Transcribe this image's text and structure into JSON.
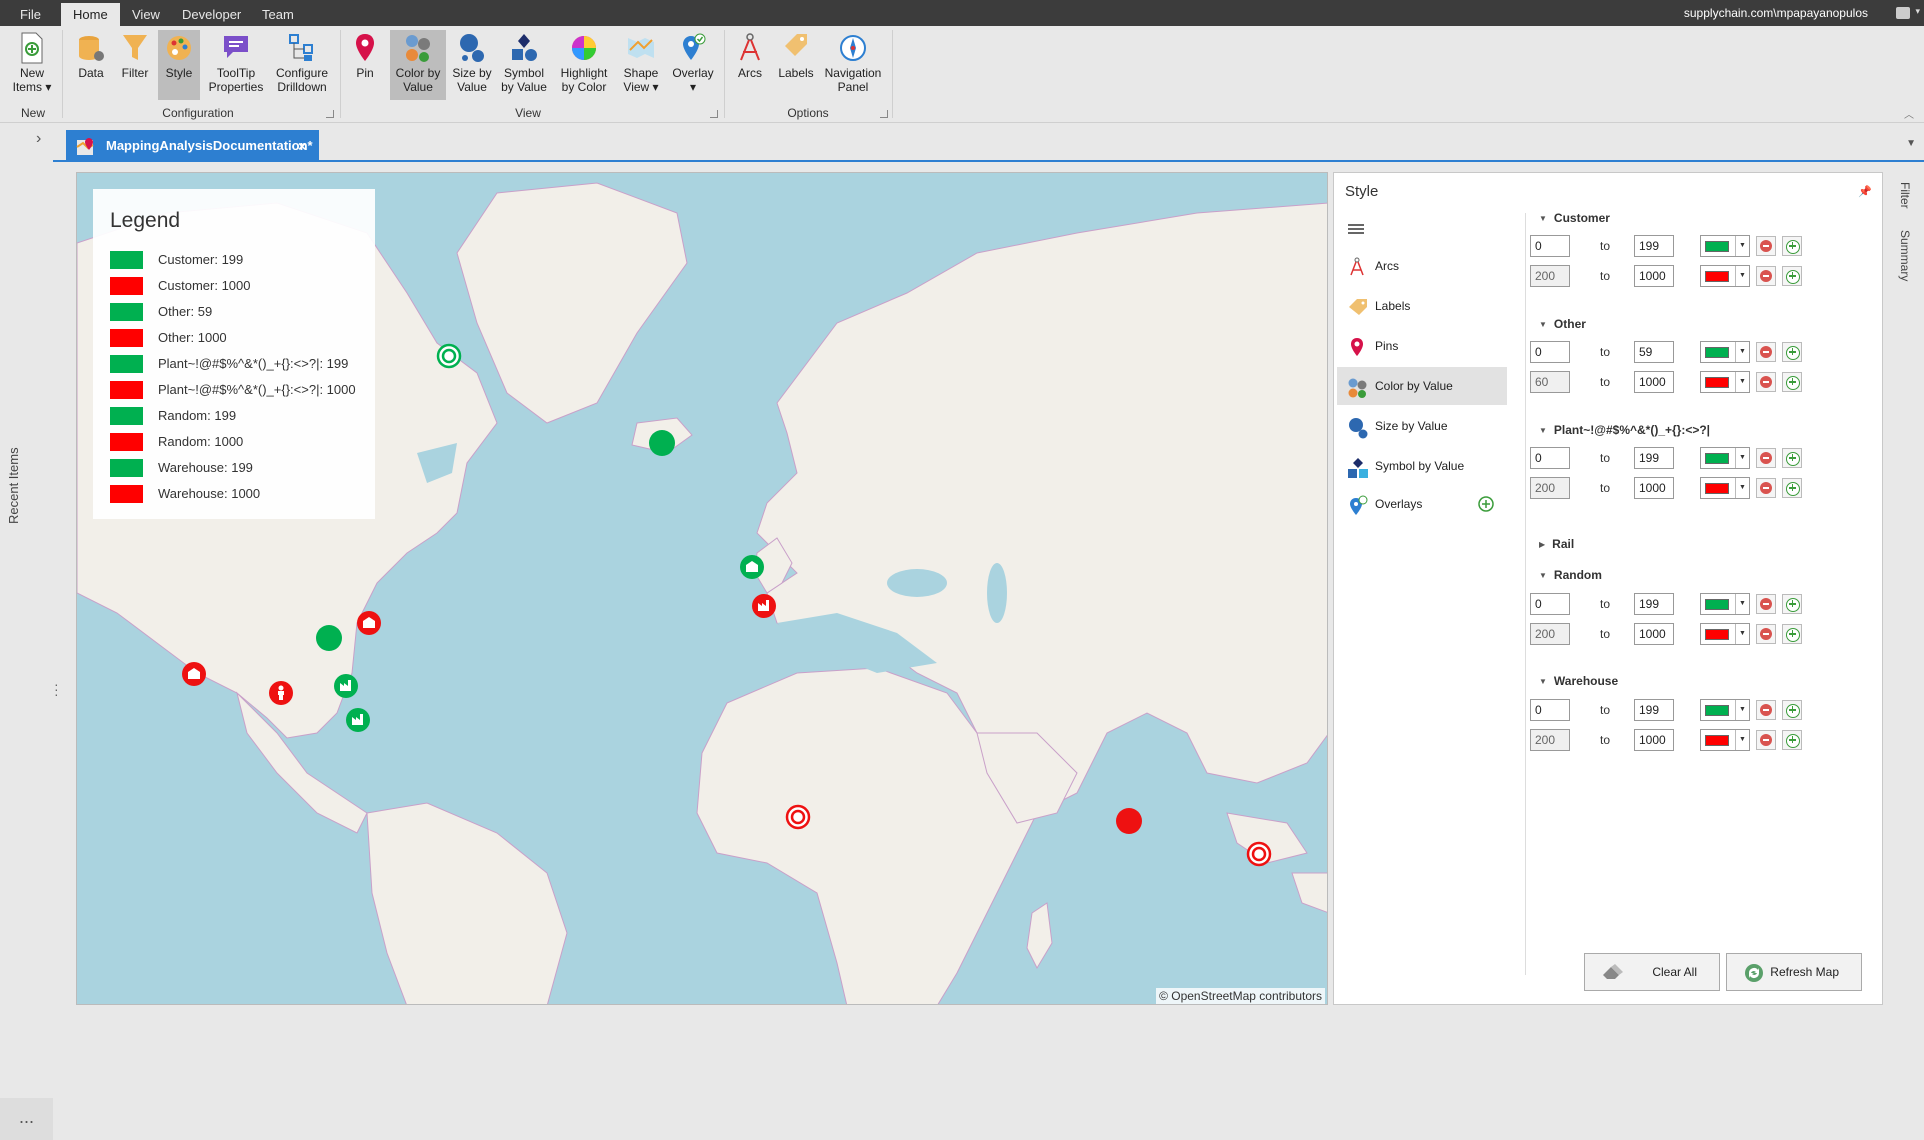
{
  "titlebar": {
    "tabs": [
      {
        "label": "File"
      },
      {
        "label": "Home"
      },
      {
        "label": "View"
      },
      {
        "label": "Developer"
      },
      {
        "label": "Team"
      }
    ],
    "user": "supplychain.com\\mpapayanopulos"
  },
  "ribbon": {
    "groups": {
      "new": "New",
      "configuration": "Configuration",
      "view": "View",
      "options": "Options"
    },
    "buttons": {
      "new_items": [
        "New",
        "Items ▾"
      ],
      "data": [
        "Data"
      ],
      "filter": [
        "Filter"
      ],
      "style": [
        "Style"
      ],
      "tooltip_properties": [
        "ToolTip",
        "Properties"
      ],
      "configure_drilldown": [
        "Configure",
        "Drilldown"
      ],
      "pin": [
        "Pin"
      ],
      "color_by_value": [
        "Color by",
        "Value"
      ],
      "size_by_value": [
        "Size by",
        "Value"
      ],
      "symbol_by_value": [
        "Symbol",
        "by Value"
      ],
      "highlight_by_color": [
        "Highlight",
        "by Color"
      ],
      "shape_view": [
        "Shape",
        "View ▾"
      ],
      "overlay": [
        "Overlay",
        "▾"
      ],
      "arcs": [
        "Arcs"
      ],
      "labels": [
        "Labels"
      ],
      "navigation_panel": [
        "Navigation",
        "Panel"
      ]
    }
  },
  "left_rail": {
    "recent_items": "Recent Items",
    "more": "..."
  },
  "document_tab": {
    "title": "MappingAnalysisDocumentation*",
    "close": "×"
  },
  "legend": {
    "title": "Legend",
    "items": [
      {
        "label": "Customer: 199",
        "color": "#00b050"
      },
      {
        "label": "Customer: 1000",
        "color": "#ff0000"
      },
      {
        "label": "Other: 59",
        "color": "#00b050"
      },
      {
        "label": "Other: 1000",
        "color": "#ff0000"
      },
      {
        "label": "Plant~!@#$%^&*()_+{}:<>?|: 199",
        "color": "#00b050"
      },
      {
        "label": "Plant~!@#$%^&*()_+{}:<>?|: 1000",
        "color": "#ff0000"
      },
      {
        "label": "Random: 199",
        "color": "#00b050"
      },
      {
        "label": "Random: 1000",
        "color": "#ff0000"
      },
      {
        "label": "Warehouse: 199",
        "color": "#00b050"
      },
      {
        "label": "Warehouse: 1000",
        "color": "#ff0000"
      }
    ]
  },
  "map": {
    "attribution": "© OpenStreetMap contributors"
  },
  "style_panel": {
    "title": "Style",
    "nav": [
      {
        "label": "Arcs"
      },
      {
        "label": "Labels"
      },
      {
        "label": "Pins"
      },
      {
        "label": "Color by Value"
      },
      {
        "label": "Size by Value"
      },
      {
        "label": "Symbol by Value"
      },
      {
        "label": "Overlays"
      }
    ],
    "range_separator": "to",
    "sections": [
      {
        "name": "Customer",
        "expanded": true,
        "rows": [
          {
            "min": "0",
            "max": "199",
            "color": "#00b050"
          },
          {
            "min": "200",
            "max": "1000",
            "color": "#ff0000"
          }
        ]
      },
      {
        "name": "Other",
        "expanded": true,
        "rows": [
          {
            "min": "0",
            "max": "59",
            "color": "#00b050"
          },
          {
            "min": "60",
            "max": "1000",
            "color": "#ff0000"
          }
        ]
      },
      {
        "name": "Plant~!@#$%^&*()_+{}:<>?|",
        "expanded": true,
        "rows": [
          {
            "min": "0",
            "max": "199",
            "color": "#00b050"
          },
          {
            "min": "200",
            "max": "1000",
            "color": "#ff0000"
          }
        ]
      },
      {
        "name": "Rail",
        "expanded": false,
        "rows": []
      },
      {
        "name": "Random",
        "expanded": true,
        "rows": [
          {
            "min": "0",
            "max": "199",
            "color": "#00b050"
          },
          {
            "min": "200",
            "max": "1000",
            "color": "#ff0000"
          }
        ]
      },
      {
        "name": "Warehouse",
        "expanded": true,
        "rows": [
          {
            "min": "0",
            "max": "199",
            "color": "#00b050"
          },
          {
            "min": "200",
            "max": "1000",
            "color": "#ff0000"
          }
        ]
      }
    ],
    "clear_all": "Clear All",
    "refresh_map": "Refresh Map"
  },
  "right_rail": {
    "filter": "Filter",
    "summary": "Summary"
  },
  "colors": {
    "accent": "#2d7fd1",
    "low": "#00b050",
    "high": "#ff0000"
  }
}
